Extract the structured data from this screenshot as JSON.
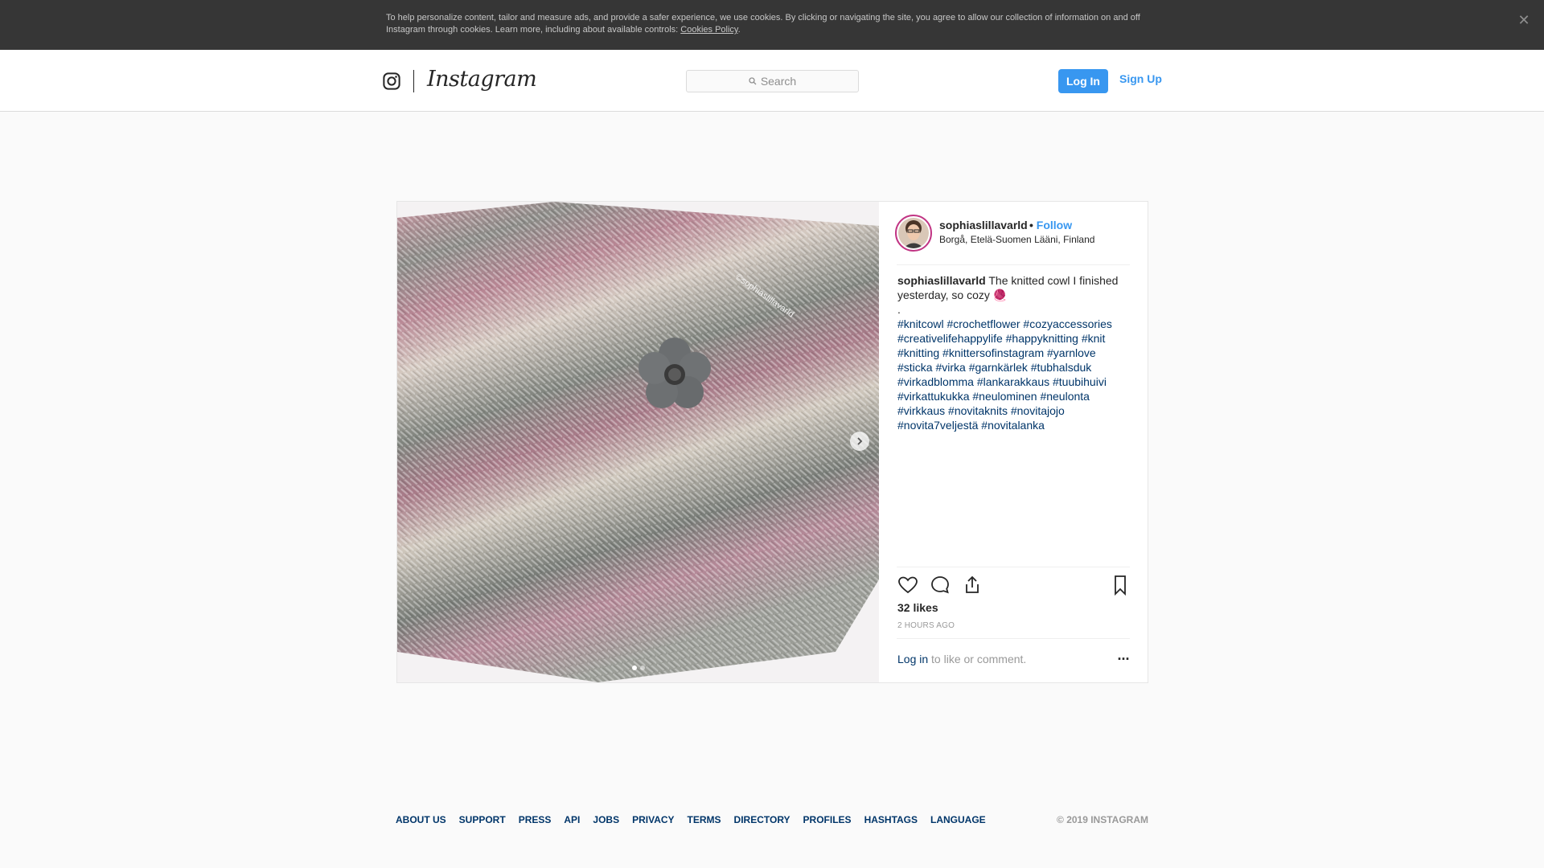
{
  "cookie_banner": {
    "text": "To help personalize content, tailor and measure ads, and provide a safer experience, we use cookies. By clicking or navigating the site, you agree to allow our collection of information on and off Instagram through cookies. Learn more, including about available controls: ",
    "link": "Cookies Policy",
    "suffix": ".",
    "close_glyph": "✕"
  },
  "header": {
    "logo_text": "Instagram",
    "search_placeholder": "Search",
    "login_label": "Log In",
    "signup_label": "Sign Up"
  },
  "post": {
    "username": "sophiaslillavarld",
    "follow_separator": "•",
    "follow_label": "Follow",
    "location": "Borgå, Etelä-Suomen Lääni, Finland",
    "watermark": "©sophiaslillavarld",
    "caption_text": " The knitted cowl I finished yesterday, so cozy 🧶",
    "caption_dot": ".",
    "hashtags": [
      "#knitcowl",
      "#crochetflower",
      "#cozyaccessories",
      "#creativelifehappylife",
      "#happyknitting",
      "#knit",
      "#knitting",
      "#knittersofinstagram",
      "#yarnlove",
      "#sticka",
      "#virka",
      "#garnkärlek",
      "#tubhalsduk",
      "#virkadblomma",
      "#lankarakkaus",
      "#tuubihuivi",
      "#virkattukukka",
      "#neulominen",
      "#neulonta",
      "#virkkaus",
      "#novitaknits",
      "#novitajojo",
      "#novita7veljestä",
      "#novitalanka"
    ],
    "likes": "32 likes",
    "time": "2 HOURS AGO",
    "comment_login": "Log in",
    "comment_rest": " to like or comment.",
    "more_glyph": "..."
  },
  "footer": {
    "links": [
      "ABOUT US",
      "SUPPORT",
      "PRESS",
      "API",
      "JOBS",
      "PRIVACY",
      "TERMS",
      "DIRECTORY",
      "PROFILES",
      "HASHTAGS",
      "LANGUAGE"
    ],
    "copyright": "© 2019 INSTAGRAM"
  },
  "colors": {
    "brand_blue": "#3897f0",
    "link_dark_blue": "#003569",
    "banner_bg": "#363636"
  }
}
